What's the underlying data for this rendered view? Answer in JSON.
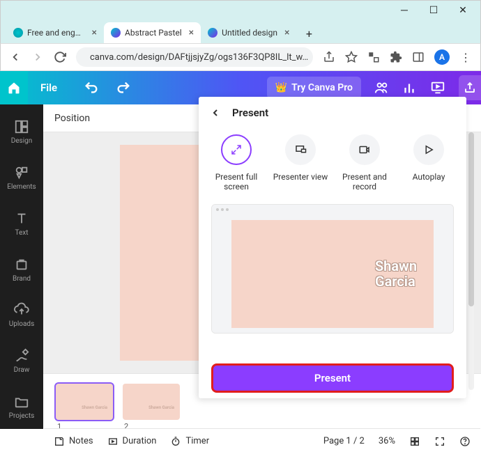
{
  "window": {
    "tabs": [
      {
        "title": "Free and engaging",
        "active": false
      },
      {
        "title": "Abstract Pastel",
        "active": true
      },
      {
        "title": "Untitled design",
        "active": false
      }
    ]
  },
  "browser": {
    "url": "canva.com/design/DAFtjjsjyZg/ogs136F3QP8IL_lt_w…",
    "avatar_letter": "A"
  },
  "canva_bar": {
    "file_label": "File",
    "try_pro_label": "Try Canva Pro"
  },
  "sidebar": {
    "items": [
      {
        "label": "Design"
      },
      {
        "label": "Elements"
      },
      {
        "label": "Text"
      },
      {
        "label": "Brand"
      },
      {
        "label": "Uploads"
      },
      {
        "label": "Draw"
      },
      {
        "label": "Projects"
      }
    ]
  },
  "toolbar": {
    "position_label": "Position"
  },
  "thumbnails": {
    "slide1_num": "1",
    "slide2_num": "2",
    "thumb_text1": "Shawn Garcia",
    "thumb_text2": "Shawn Garcia"
  },
  "popover": {
    "title": "Present",
    "options": {
      "full": "Present full screen",
      "presenter": "Presenter view",
      "record": "Present and record",
      "autoplay": "Autoplay"
    },
    "preview_name_line1": "Shawn",
    "preview_name_line2": "Garcia",
    "present_button": "Present"
  },
  "bottombar": {
    "notes": "Notes",
    "duration": "Duration",
    "timer": "Timer",
    "page": "Page 1 / 2",
    "zoom": "36%"
  }
}
